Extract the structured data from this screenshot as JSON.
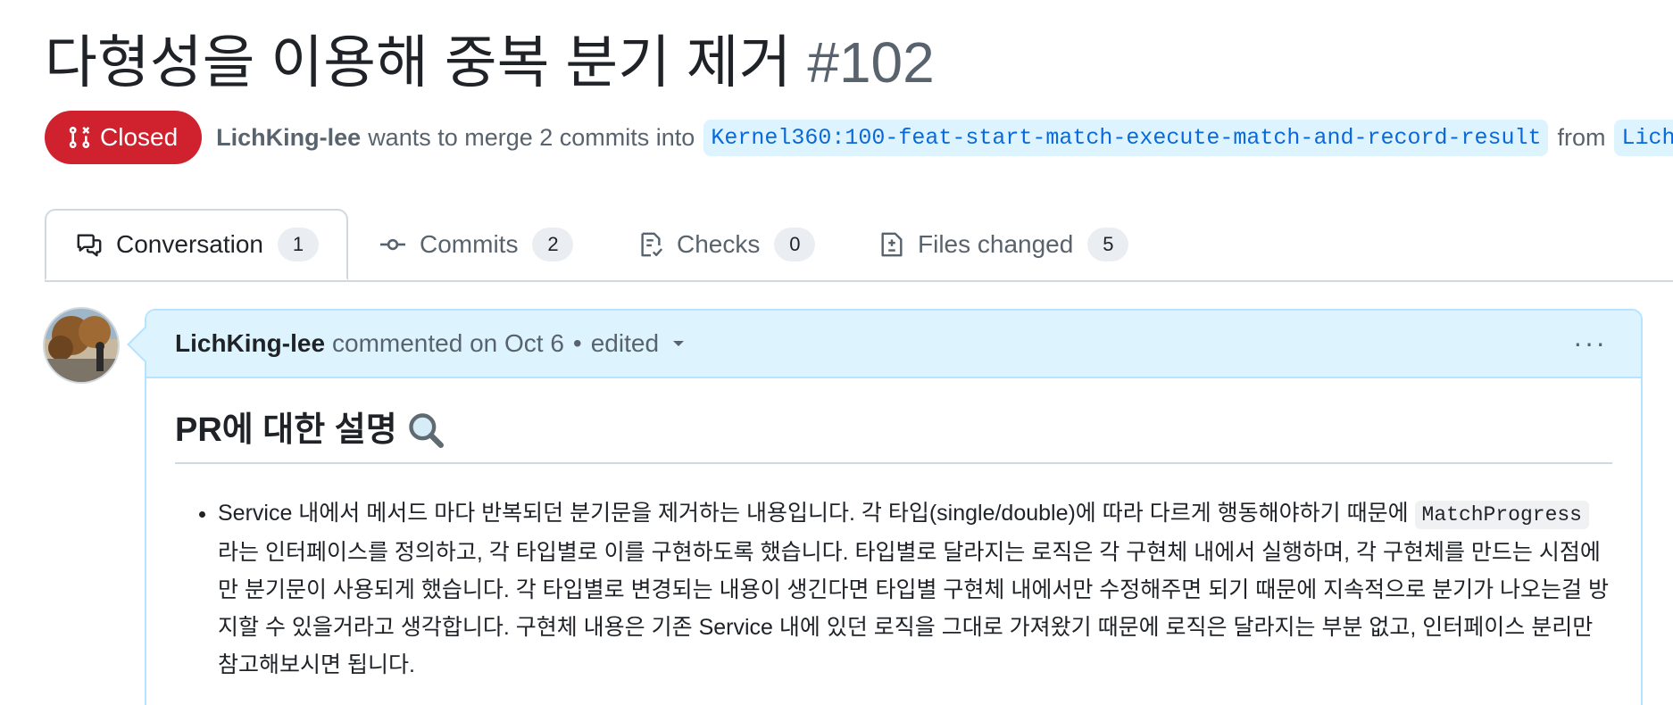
{
  "title": {
    "text": "다형성을 이용해 중복 분기 제거",
    "number": "#102"
  },
  "meta": {
    "state_label": "Closed",
    "author": "LichKing-lee",
    "merge_text": "wants to merge 2 commits into",
    "base_branch": "Kernel360:100-feat-start-match-execute-match-and-record-result",
    "from_text": "from",
    "head_branch_visible": "Lich",
    "state_color": "#cf222e"
  },
  "tabs": [
    {
      "label": "Conversation",
      "count": "1",
      "icon": "comment-discussion-icon",
      "selected": true
    },
    {
      "label": "Commits",
      "count": "2",
      "icon": "git-commit-icon",
      "selected": false
    },
    {
      "label": "Checks",
      "count": "0",
      "icon": "checklist-icon",
      "selected": false
    },
    {
      "label": "Files changed",
      "count": "5",
      "icon": "file-diff-icon",
      "selected": false
    }
  ],
  "comment": {
    "author": "LichKing-lee",
    "action": "commented on Oct 6",
    "separator": "•",
    "edited": "edited",
    "menu": "···",
    "heading": "PR에 대한 설명",
    "heading_emoji": "magnifying-glass-icon",
    "bullet": {
      "part1": "Service 내에서 메서드 마다 반복되던 분기문을 제거하는 내용입니다. 각 타입(single/double)에 따라 다르게 행동해야하기 때문에 ",
      "code": "MatchProgress",
      "part2": " 라는 인터페이스를 정의하고, 각 타입별로 이를 구현하도록 했습니다. 타입별로 달라지는 로직은 각 구현체 내에서 실행하며, 각 구현체를 만드는 시점에만 분기문이 사용되게 했습니다. 각 타입별로 변경되는 내용이 생긴다면 타입별 구현체 내에서만 수정해주면 되기 때문에 지속적으로 분기가 나오는걸 방지할 수 있을거라고 생각합니다. 구현체 내용은 기존 Service 내에 있던 로직을 그대로 가져왔기 때문에 로직은 달라지는 부분 없고, 인터페이스 분리만 참고해보시면 됩니다."
    },
    "header_bg": "#ddf4ff",
    "border_color": "#b6e3ff"
  }
}
